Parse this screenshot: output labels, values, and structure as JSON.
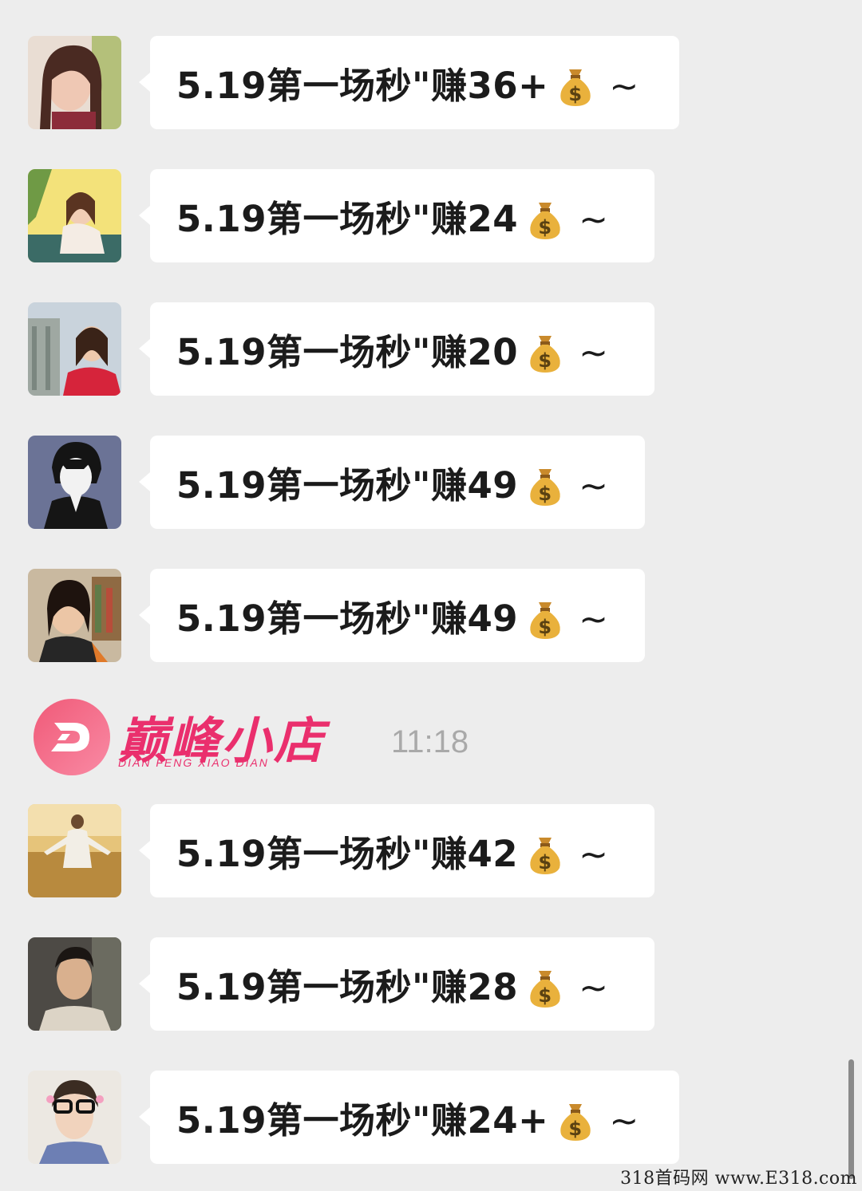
{
  "messages": [
    {
      "text": "5.19第一场秒\"赚36+",
      "suffix": "~"
    },
    {
      "text": "5.19第一场秒\"赚24",
      "suffix": "~"
    },
    {
      "text": "5.19第一场秒\"赚20",
      "suffix": "~"
    },
    {
      "text": "5.19第一场秒\"赚49",
      "suffix": "~"
    },
    {
      "text": "5.19第一场秒\"赚49",
      "suffix": "~"
    },
    {
      "text": "5.19第一场秒\"赚42",
      "suffix": "~"
    },
    {
      "text": "5.19第一场秒\"赚28",
      "suffix": "~"
    },
    {
      "text": "5.19第一场秒\"赚24+",
      "suffix": "~"
    }
  ],
  "emoji_icon": "money-bag",
  "divider": {
    "logo_title": "巅峰小店",
    "logo_subtitle": "DIAN FENG XIAO DIAN",
    "timestamp": "11:18"
  },
  "watermark": "318首码网 www.E318.com",
  "colors": {
    "background": "#ededed",
    "bubble": "#ffffff",
    "brand": "#ea2f6d"
  }
}
